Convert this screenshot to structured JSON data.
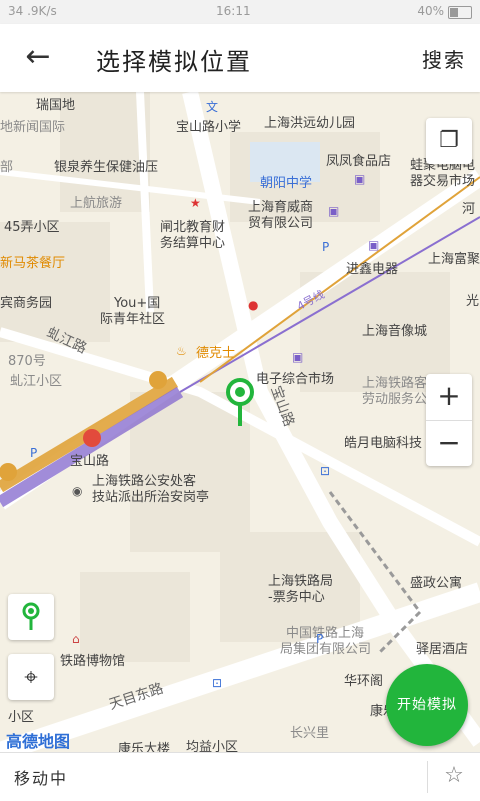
{
  "statusbar": {
    "left": "34  .9K/s",
    "time": "16:11",
    "battery": "40%"
  },
  "appbar": {
    "title": "选择模拟位置",
    "search_label": "搜索",
    "back_symbol": "←"
  },
  "map": {
    "labels": [
      {
        "text": "瑞国地"
      },
      {
        "text": "宝山路小学"
      },
      {
        "text": "上海洪远幼儿园"
      },
      {
        "text": "银泉养生保健油压"
      },
      {
        "text": "凤凤食品店"
      },
      {
        "text": "蛙聚电脑电"
      },
      {
        "text": "器交易市场"
      },
      {
        "text": "上航旅游"
      },
      {
        "text": "朝阳中学"
      },
      {
        "text": "45弄小区"
      },
      {
        "text": "闸北教育财"
      },
      {
        "text": "务结算中心"
      },
      {
        "text": "上海育威商"
      },
      {
        "text": "贸有限公司"
      },
      {
        "text": "新马茶餐厅"
      },
      {
        "text": "进鑫电器"
      },
      {
        "text": "上海富聚"
      },
      {
        "text": "宾商务园"
      },
      {
        "text": "You+国"
      },
      {
        "text": "际青年社区"
      },
      {
        "text": "上海音像城"
      },
      {
        "text": "虬江路"
      },
      {
        "text": "德克士"
      },
      {
        "text": "电子综合市场"
      },
      {
        "text": "870号"
      },
      {
        "text": "虬江小区"
      },
      {
        "text": "上海铁路客"
      },
      {
        "text": "劳动服务公"
      },
      {
        "text": "宝山路"
      },
      {
        "text": "皓月电脑科技"
      },
      {
        "text": "上海铁路公安处客"
      },
      {
        "text": "技站派出所治安岗亭"
      },
      {
        "text": "宝山路"
      },
      {
        "text": "上海铁路局"
      },
      {
        "text": "-票务中心"
      },
      {
        "text": "盛政公寓"
      },
      {
        "text": "中国铁路上海"
      },
      {
        "text": "局集团有限公司"
      },
      {
        "text": "驿居酒店"
      },
      {
        "text": "铁路博物馆"
      },
      {
        "text": "华环阁"
      },
      {
        "text": "天目东路"
      },
      {
        "text": "康乐"
      },
      {
        "text": "长兴里"
      },
      {
        "text": "康乐大楼"
      },
      {
        "text": "均益小区"
      },
      {
        "text": "小区"
      },
      {
        "text": "4号线"
      },
      {
        "text": "光"
      },
      {
        "text": "地新闻国际"
      },
      {
        "text": "部"
      },
      {
        "text": "河"
      }
    ],
    "logo": "高德地图"
  },
  "controls": {
    "layers_icon": "layers-icon",
    "zoom_in": "+",
    "zoom_out": "−",
    "locate_icon": "⌖"
  },
  "start_button_label": "开始模拟",
  "bottombar": {
    "status": "移动中",
    "star": "☆"
  },
  "colors": {
    "pin": "#22b53c",
    "start_button": "#22b53c",
    "metro_line1": "#e0a33a",
    "metro_line4": "#8a6fd0"
  }
}
